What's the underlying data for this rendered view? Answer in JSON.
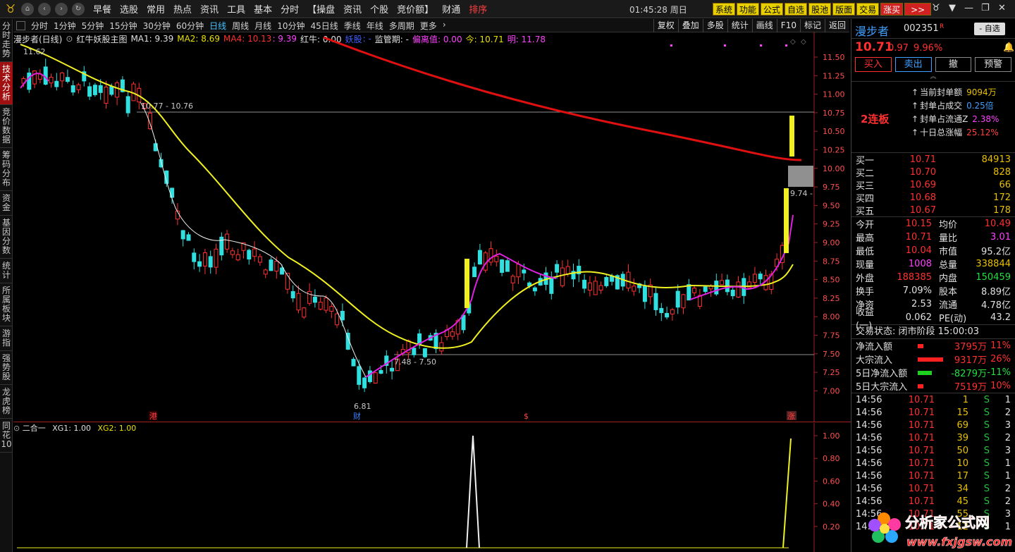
{
  "topbar": {
    "menus": [
      "早餐",
      "选股",
      "常用",
      "热点",
      "资讯",
      "工具",
      "基本",
      "分时",
      "【操盘",
      "资讯",
      "个股",
      "竞价额】",
      "财通"
    ],
    "menu_red": "排序",
    "clock": "01:45:28 周日",
    "yellow_buttons": [
      "系统",
      "功能",
      "公式",
      "自选",
      "股池",
      "版面",
      "交易"
    ],
    "red_button": "涨买",
    "arrow_button": ">>",
    "window_controls": [
      "▼",
      "—",
      "❐",
      "✕"
    ]
  },
  "lefttabs": [
    "分时走势",
    "技术分析",
    "竞价数据",
    "筹码分布",
    "资金",
    "基因分数",
    "统计",
    "所属板块",
    "游指",
    "强势股",
    "龙虎榜",
    "同花10"
  ],
  "periodbar": {
    "periods": [
      "分时",
      "1分钟",
      "5分钟",
      "15分钟",
      "30分钟",
      "60分钟",
      "日线",
      "周线",
      "月线",
      "10分钟",
      "45日线",
      "季线",
      "年线",
      "多周期",
      "更多"
    ],
    "active": "日线",
    "right_buttons": [
      "复权",
      "叠加",
      "多股",
      "统计",
      "画线",
      "F10",
      "标记",
      "返回"
    ]
  },
  "indicator": {
    "stock": "漫步者(日线)",
    "formula": "红牛妖股主图",
    "ma1": "MA1: 9.39",
    "ma2": "MA2: 8.69",
    "ma4": "MA4: 10.13",
    "sep": ": 9.39",
    "hongniu": "红牛: 0.00",
    "yao": "妖股",
    "dot": ": -",
    "jgq": "监管期: -",
    "plz": "偏离值: 0.00",
    "jin": "今: 10.71",
    "ming": "明: 11.78"
  },
  "chart": {
    "y_ticks": [
      "11.50",
      "11.25",
      "11.00",
      "10.75",
      "10.50",
      "10.25",
      "10.00",
      "9.75",
      "9.50",
      "9.25",
      "9.00",
      "8.75",
      "8.50",
      "8.25",
      "8.00",
      "7.75",
      "7.50",
      "7.25",
      "7.00"
    ],
    "annotations": {
      "high": "11.62",
      "level1": "10.77 - 10.76",
      "level2": "7.48 - 7.50",
      "low": "6.81",
      "price_tag": "9.74 -"
    },
    "markers": [
      "港",
      "财",
      "$",
      "涨"
    ]
  },
  "sub": {
    "title": "二合一",
    "xg1": "XG1: 1.00",
    "xg2": "XG2: 1.00",
    "y_ticks": [
      "1.00",
      "0.80",
      "0.60",
      "0.40",
      "0.20"
    ]
  },
  "chart_data": {
    "type": "candlestick",
    "title": "漫步者(日线)",
    "y_range": [
      6.81,
      11.62
    ],
    "support_lines": [
      10.76,
      7.5
    ],
    "last_close": 10.71
  },
  "panel": {
    "name": "漫步者",
    "code": "002351",
    "tag": "R",
    "select": "- 自选",
    "price": "10.71",
    "change": "0.97",
    "pct": "9.96%",
    "trade_buttons": [
      "买入",
      "卖出",
      "撤",
      "预警"
    ],
    "seal_label": "2连板",
    "seal_rows": [
      {
        "k": "当前封单额",
        "v": "9094万",
        "cls": "yel"
      },
      {
        "k": "封单占成交",
        "v": "0.25倍",
        "cls": ""
      },
      {
        "k": "封单占流通Z",
        "v": "2.38%",
        "cls": "mag"
      },
      {
        "k": "十日总涨幅",
        "v": "25.12%",
        "cls": "red"
      }
    ],
    "orderbook": [
      {
        "l": "买一",
        "p": "10.71",
        "v": "84913"
      },
      {
        "l": "买二",
        "p": "10.70",
        "v": "828"
      },
      {
        "l": "买三",
        "p": "10.69",
        "v": "66"
      },
      {
        "l": "买四",
        "p": "10.68",
        "v": "172"
      },
      {
        "l": "买五",
        "p": "10.67",
        "v": "178"
      }
    ],
    "quotes": [
      {
        "k1": "今开",
        "v1": "10.15",
        "c1": "#ff3030",
        "k2": "均价",
        "v2": "10.49",
        "c2": "#ff3030"
      },
      {
        "k1": "最高",
        "v1": "10.71",
        "c1": "#ff3030",
        "k2": "量比",
        "v2": "3.01",
        "c2": "#ff40ff"
      },
      {
        "k1": "最低",
        "v1": "10.04",
        "c1": "#ff3030",
        "k2": "市值",
        "v2": "95.2亿",
        "c2": "#e0e0e0"
      },
      {
        "k1": "现量",
        "v1": "1008",
        "c1": "#ff40ff",
        "k2": "总量",
        "v2": "338844",
        "c2": "#e8c000"
      },
      {
        "k1": "外盘",
        "v1": "188385",
        "c1": "#ff3030",
        "k2": "内盘",
        "v2": "150459",
        "c2": "#20e040"
      },
      {
        "k1": "换手",
        "v1": "7.09%",
        "c1": "#e0e0e0",
        "k2": "股本",
        "v2": "8.89亿",
        "c2": "#e0e0e0"
      },
      {
        "k1": "净资",
        "v1": "2.53",
        "c1": "#e0e0e0",
        "k2": "流通",
        "v2": "4.78亿",
        "c2": "#e0e0e0"
      },
      {
        "k1": "收益(一)",
        "v1": "0.062",
        "c1": "#e0e0e0",
        "k2": "PE(动)",
        "v2": "43.2",
        "c2": "#e0e0e0"
      }
    ],
    "trade_status": "交易状态: 闭市阶段 15:00:03",
    "flows": [
      {
        "k": "净流入额",
        "bar": "#ff2020",
        "v": "3795万",
        "p": "11%",
        "c": "#ff3030",
        "w": 8
      },
      {
        "k": "大宗流入",
        "bar": "#ff2020",
        "v": "9317万",
        "p": "26%",
        "c": "#ff3030",
        "w": 36
      },
      {
        "k": "5日净流入额",
        "bar": "#20d020",
        "v": "-8279万",
        "p": "-11%",
        "c": "#20e040",
        "w": 20
      },
      {
        "k": "5日大宗流入",
        "bar": "#ff2020",
        "v": "7519万",
        "p": "10%",
        "c": "#ff3030",
        "w": 8
      }
    ],
    "ticks": [
      {
        "t": "14:56",
        "p": "10.71",
        "v": "1",
        "s": "S",
        "n": "1"
      },
      {
        "t": "14:56",
        "p": "10.71",
        "v": "15",
        "s": "S",
        "n": "2"
      },
      {
        "t": "14:56",
        "p": "10.71",
        "v": "69",
        "s": "S",
        "n": "3"
      },
      {
        "t": "14:56",
        "p": "10.71",
        "v": "39",
        "s": "S",
        "n": "2"
      },
      {
        "t": "14:56",
        "p": "10.71",
        "v": "50",
        "s": "S",
        "n": "3"
      },
      {
        "t": "14:56",
        "p": "10.71",
        "v": "10",
        "s": "S",
        "n": "1"
      },
      {
        "t": "14:56",
        "p": "10.71",
        "v": "17",
        "s": "S",
        "n": "1"
      },
      {
        "t": "14:56",
        "p": "10.71",
        "v": "34",
        "s": "S",
        "n": "2"
      },
      {
        "t": "14:56",
        "p": "10.71",
        "v": "45",
        "s": "S",
        "n": "2"
      },
      {
        "t": "14:56",
        "p": "10.71",
        "v": "55",
        "s": "S",
        "n": "3"
      },
      {
        "t": "14:56",
        "p": "10.71",
        "v": "12",
        "s": "S",
        "n": "1"
      }
    ]
  },
  "watermark": {
    "cn": "分析家公式网",
    "url": "www.fxjgsw.com"
  }
}
